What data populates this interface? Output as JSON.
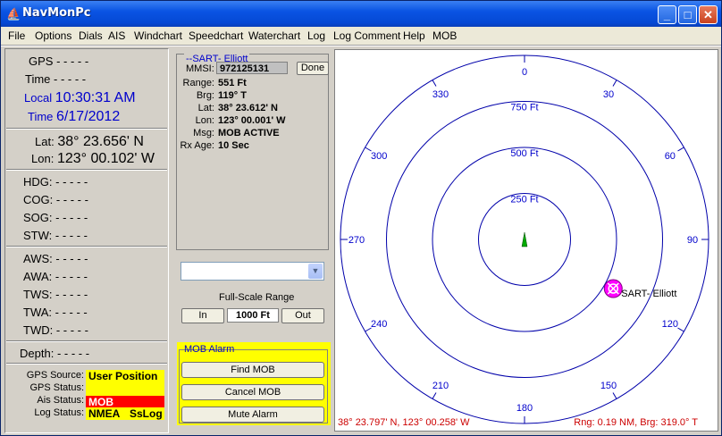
{
  "window": {
    "title": "NavMonPc",
    "icon": "sailboat-icon",
    "controls": {
      "minimize": "_",
      "maximize": "□",
      "close": "✕"
    }
  },
  "menu": [
    "File",
    "Options",
    "Dials",
    "AIS",
    "Windchart",
    "Speedchart",
    "Waterchart",
    "Log",
    "Log Comment",
    "Help",
    "MOB"
  ],
  "left": {
    "gps_label": "GPS",
    "gps_value": "- - - - -",
    "time_label": "Time",
    "time_value": "- - - - -",
    "local_label": "Local",
    "local_value": "10:30:31 AM",
    "date_label": "Time",
    "date_value": "6/17/2012",
    "lat_label": "Lat:",
    "lat_value": "38° 23.656' N",
    "lon_label": "Lon:",
    "lon_value": "123° 00.102' W",
    "nav": [
      {
        "label": "HDG:",
        "value": "- - - - -"
      },
      {
        "label": "COG:",
        "value": "- - - - -"
      },
      {
        "label": "SOG:",
        "value": "- - - - -"
      },
      {
        "label": "STW:",
        "value": "- - - - -"
      }
    ],
    "wind": [
      {
        "label": "AWS:",
        "value": "- - - - -"
      },
      {
        "label": "AWA:",
        "value": "- - - - -"
      },
      {
        "label": "TWS:",
        "value": "- - - - -"
      },
      {
        "label": "TWA:",
        "value": "- - - - -"
      },
      {
        "label": "TWD:",
        "value": "- - - - -"
      }
    ],
    "depth_label": "Depth:",
    "depth_value": "- - - - -",
    "status": {
      "gps_source_label": "GPS Source:",
      "gps_source_value": "User Position",
      "gps_status_label": "GPS Status:",
      "gps_status_value": "",
      "ais_status_label": "Ais Status:",
      "ais_status_value": "MOB",
      "log_status_label": "Log Status:",
      "log_status_value_1": "NMEA",
      "log_status_value_2": "SsLog"
    }
  },
  "sart": {
    "legend": "--SART- Elliott",
    "mmsi_label": "MMSI:",
    "mmsi_value": "972125131",
    "done_button": "Done",
    "rows": [
      {
        "label": "Range:",
        "value": "551 Ft"
      },
      {
        "label": "Brg:",
        "value": "119° T"
      },
      {
        "label": "Lat:",
        "value": "38° 23.612' N"
      },
      {
        "label": "Lon:",
        "value": "123° 00.001' W"
      },
      {
        "label": "Msg:",
        "value": "MOB ACTIVE"
      },
      {
        "label": "Rx Age:",
        "value": "10 Sec"
      }
    ]
  },
  "range": {
    "combo_value": "",
    "label": "Full-Scale Range",
    "in_button": "In",
    "value": "1000 Ft",
    "out_button": "Out"
  },
  "mob": {
    "legend": "MOB Alarm",
    "find_button": "Find MOB",
    "cancel_button": "Cancel MOB",
    "mute_button": "Mute Alarm"
  },
  "radar": {
    "ring_labels": [
      "250 Ft",
      "500 Ft",
      "750 Ft"
    ],
    "bearings": [
      "0",
      "30",
      "60",
      "90",
      "120",
      "150",
      "180",
      "210",
      "240",
      "270",
      "300",
      "330"
    ],
    "target_label": "SART- Elliott",
    "target_bearing_deg": 119,
    "target_range_ft": 551,
    "full_scale_ft": 1000,
    "footer_left": "38° 23.797' N, 123° 00.258' W",
    "footer_right": "Rng: 0.19 NM, Brg: 319.0° T",
    "ring_color": "#0000aa",
    "label_color": "#0000cc",
    "footer_color": "#cc0000",
    "target_color": "#ff00ff",
    "vessel_color": "#00aa00"
  }
}
